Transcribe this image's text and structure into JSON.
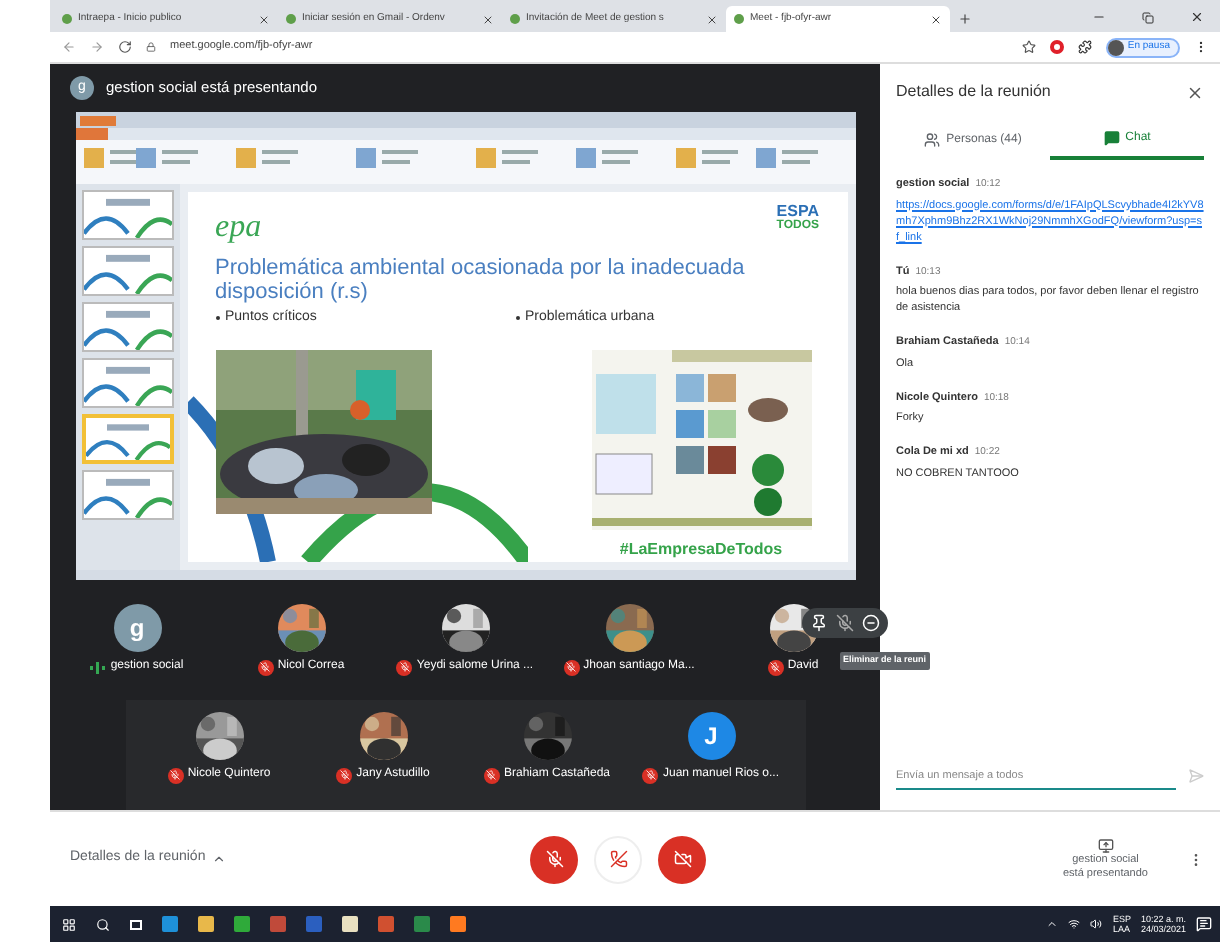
{
  "browser": {
    "tabs": [
      {
        "title": "Intraepa - Inicio publico",
        "selected": false
      },
      {
        "title": "Iniciar sesión en Gmail - Ordenv",
        "selected": false
      },
      {
        "title": "Invitación de Meet de gestion s",
        "selected": false
      },
      {
        "title": "Meet - fjb-ofyr-awr",
        "selected": true
      }
    ],
    "url": "meet.google.com/fjb-ofyr-awr",
    "profile_status": "En pausa"
  },
  "presenter_banner": {
    "avatar_letter": "g",
    "text": "gestion social está presentando"
  },
  "slide": {
    "logo": "epa",
    "brand_top": "ESPA",
    "brand_bottom": "TODOS",
    "title": "Problemática ambiental  ocasionada por la inadecuada disposición (r.s)",
    "bullets": [
      "Puntos críticos",
      "Problemática urbana"
    ],
    "hashtag": "#LaEmpresaDeTodos",
    "thumbnails": [
      {
        "selected": false
      },
      {
        "selected": false
      },
      {
        "selected": false
      },
      {
        "selected": false
      },
      {
        "selected": true
      },
      {
        "selected": false
      }
    ]
  },
  "participant_rows": [
    [
      {
        "name": "gestion social",
        "kind": "letter",
        "letter": "g",
        "color": "#7f9aa8",
        "muted": false,
        "hovered": false
      },
      {
        "name": "Nicol Correa",
        "kind": "picture",
        "muted": true,
        "hovered": false
      },
      {
        "name": "Yeydi salome Urina ...",
        "kind": "picture",
        "muted": true,
        "hovered": false
      },
      {
        "name": "Jhoan santiago Ma...",
        "kind": "picture",
        "muted": true,
        "hovered": false
      },
      {
        "name": "David",
        "kind": "picture",
        "muted": true,
        "hovered": true,
        "tooltip": "Eliminar de la reuni"
      }
    ],
    [
      {
        "name": "Nicole Quintero",
        "kind": "picture",
        "muted": true,
        "hovered": false
      },
      {
        "name": "Jany Astudillo",
        "kind": "picture",
        "muted": true,
        "hovered": false
      },
      {
        "name": "Brahiam Castañeda",
        "kind": "picture",
        "muted": true,
        "hovered": false
      },
      {
        "name": "Juan manuel Rios o...",
        "kind": "letter",
        "letter": "J",
        "color": "#1e88e5",
        "muted": true,
        "hovered": false
      }
    ]
  ],
  "panel": {
    "title": "Detalles de la reunión",
    "tabs": [
      {
        "label": "Personas (44)",
        "selected": false
      },
      {
        "label": "Chat",
        "selected": true
      }
    ],
    "messages": [
      {
        "sender": "gestion social",
        "time": "10:12",
        "kind": "link",
        "text": "https://docs.google.com/forms/d/e/1FAIpQLScvybhade4I2kYV8mh7Xphm9Bhz2RX1WkNoj29NmmhXGodFQ/viewform?usp=sf_link"
      },
      {
        "sender": "Tú",
        "time": "10:13",
        "kind": "text",
        "text": "hola buenos dias para todos, por favor deben llenar  el registro de asistencia"
      },
      {
        "sender": "Brahiam Castañeda",
        "time": "10:14",
        "kind": "text",
        "text": "Ola"
      },
      {
        "sender": "Nicole Quintero",
        "time": "10:18",
        "kind": "text",
        "text": "Forky"
      },
      {
        "sender": "Cola De mi xd",
        "time": "10:22",
        "kind": "text",
        "text": "NO COBREN TANTOOO"
      }
    ],
    "input_placeholder": "Envía un mensaje a todos"
  },
  "bottom_bar": {
    "details_label": "Detalles de la reunión",
    "mic_on": false,
    "camera_on": false,
    "presenting_line1": "gestion social",
    "presenting_line2": "está presentando"
  },
  "taskbar": {
    "language_top": "ESP",
    "language_bottom": "LAA",
    "time": "10:22 a. m.",
    "date": "24/03/2021"
  }
}
